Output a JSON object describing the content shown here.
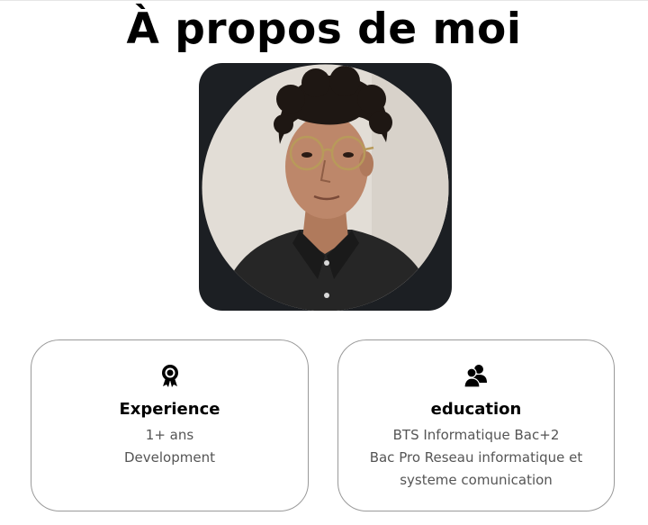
{
  "header": {
    "title": "À propos de moi"
  },
  "profile": {
    "photo_icon": "portrait-photo"
  },
  "cards": [
    {
      "icon": "award-icon",
      "title": "Experience",
      "lines": [
        "1+ ans",
        "Development"
      ]
    },
    {
      "icon": "users-icon",
      "title": "education",
      "lines": [
        "BTS Informatique Bac+2",
        "Bac Pro Reseau informatique et",
        "systeme comunication"
      ]
    }
  ],
  "colors": {
    "text": "#000000",
    "muted_text": "#555555",
    "card_border": "#9a9a9a",
    "photo_frame": "#1c1f23",
    "photo_background": "#e2ddd6"
  }
}
